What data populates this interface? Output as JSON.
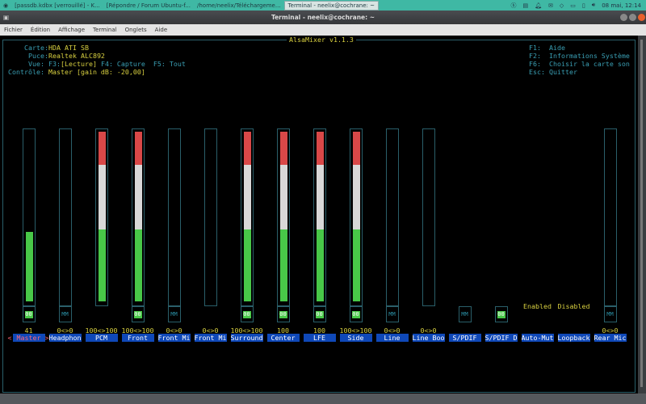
{
  "taskbar": {
    "tasks": [
      {
        "label": "[passdb.kdbx [verrouillé] - K..."
      },
      {
        "label": "[Répondre / Forum Ubuntu-f..."
      },
      {
        "label": "/home/neelix/Téléchargeme..."
      },
      {
        "label": "Terminal - neelix@cochrane: ~"
      }
    ],
    "clock": "08 mai, 12:14"
  },
  "window": {
    "title": "Terminal - neelix@cochrane: ~"
  },
  "menu": [
    "Fichier",
    "Édition",
    "Affichage",
    "Terminal",
    "Onglets",
    "Aide"
  ],
  "mixer": {
    "title": "AlsaMixer v1.1.3",
    "info": [
      {
        "key": "Carte:",
        "value": "HDA ATI SB"
      },
      {
        "key": "Puce:",
        "value": "Realtek ALC892"
      },
      {
        "key": "Vue:",
        "prefix": "F3:",
        "value": "[Lecture]",
        "rest": " F4: Capture  F5: Tout"
      },
      {
        "key": "Contrôle:",
        "value": "Master [gain dB: -20,00]"
      }
    ],
    "help": [
      "F1:  Aide",
      "F2:  Informations Système",
      "F6:  Choisir la carte son",
      "Esc: Quitter"
    ],
    "colors": {
      "red": "#d84848",
      "white": "#d8d8d8",
      "green": "#48c848"
    },
    "selected_arrows": {
      "left": "<",
      "right": ">"
    },
    "channels": [
      {
        "name": "Master",
        "value": "41",
        "level": 41,
        "meter": true,
        "mute": "00",
        "selected": true
      },
      {
        "name": "Headphon",
        "value": "0<>0",
        "level": 0,
        "meter": true,
        "mute": "MM"
      },
      {
        "name": "PCM",
        "value": "100<>100",
        "level": 100,
        "meter": true,
        "mute": null
      },
      {
        "name": "Front",
        "value": "100<>100",
        "level": 100,
        "meter": true,
        "mute": "00"
      },
      {
        "name": "Front Mi",
        "value": "0<>0",
        "level": 0,
        "meter": true,
        "mute": "MM"
      },
      {
        "name": "Front Mi",
        "value": "0<>0",
        "level": 0,
        "meter": true,
        "mute": null
      },
      {
        "name": "Surround",
        "value": "100<>100",
        "level": 100,
        "meter": true,
        "mute": "00"
      },
      {
        "name": "Center",
        "value": "100",
        "level": 100,
        "meter": true,
        "mute": "00"
      },
      {
        "name": "LFE",
        "value": "100",
        "level": 100,
        "meter": true,
        "mute": "00"
      },
      {
        "name": "Side",
        "value": "100<>100",
        "level": 100,
        "meter": true,
        "mute": "00"
      },
      {
        "name": "Line",
        "value": "0<>0",
        "level": 0,
        "meter": true,
        "mute": "MM"
      },
      {
        "name": "Line Boo",
        "value": "0<>0",
        "level": 0,
        "meter": true,
        "mute": null
      },
      {
        "name": "S/PDIF",
        "value": "",
        "level": null,
        "meter": false,
        "mute": "MM"
      },
      {
        "name": "S/PDIF D",
        "value": "",
        "level": null,
        "meter": false,
        "mute": "00"
      },
      {
        "name": "Auto-Mut",
        "value": "",
        "level": null,
        "meter": false,
        "mute": null,
        "enum": "Enabled"
      },
      {
        "name": "Loopback",
        "value": "",
        "level": null,
        "meter": false,
        "mute": null,
        "enum": "Disabled"
      },
      {
        "name": "Rear Mic",
        "value": "0<>0",
        "level": 0,
        "meter": true,
        "mute": "MM"
      }
    ]
  }
}
